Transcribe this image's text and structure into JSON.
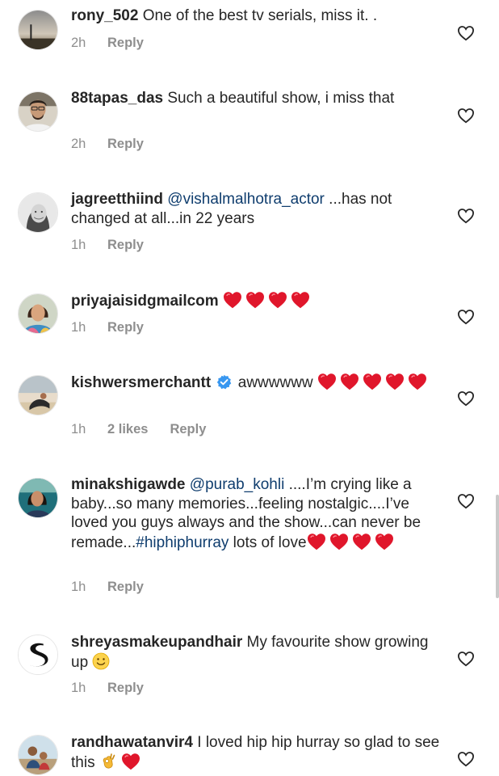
{
  "comments": [
    {
      "username": "rony_502",
      "text": " One of the best tv serials, miss it. .",
      "time": "2h",
      "reply": "Reply"
    },
    {
      "username": "88tapas_das",
      "text": " Such a beautiful show, i miss that",
      "time": "2h",
      "reply": "Reply"
    },
    {
      "username": "jagreetthiind",
      "mention": "@vishalmalhotra_actor",
      "text": " ...has not changed at all...in 22 years",
      "time": "1h",
      "reply": "Reply"
    },
    {
      "username": "priyajaisidgmailcom",
      "text": "",
      "hearts": 4,
      "time": "1h",
      "reply": "Reply"
    },
    {
      "username": "kishwersmerchantt",
      "verified": true,
      "text": " awwwwww ",
      "hearts": 5,
      "time": "1h",
      "likes": "2 likes",
      "reply": "Reply"
    },
    {
      "username": "minakshigawde",
      "mention": "@purab_kohli",
      "text": " ....I’m crying like a baby...so many memories...feeling nostalgic....I’ve loved you guys always and the show...can never be remade...",
      "hashtag": "#hiphiphurray",
      "text2": " lots of love",
      "hearts": 4,
      "time": "1h",
      "reply": "Reply"
    },
    {
      "username": "shreyasmakeupandhair",
      "text": " My favourite show growing up ",
      "emoji": "slightly-smiling-face",
      "time": "1h",
      "reply": "Reply"
    },
    {
      "username": "randhawatanvir4",
      "text": " I loved hip hip hurray so glad to see this ",
      "emoji": "ok-hand",
      "hearts": 1
    }
  ],
  "colors": {
    "username": "#262626",
    "meta": "#8e8e8e",
    "link": "#0f3d6e",
    "heart_emoji": "#e0162b"
  },
  "icons": {
    "like": "heart-outline-icon",
    "verified": "verified-badge-icon"
  }
}
